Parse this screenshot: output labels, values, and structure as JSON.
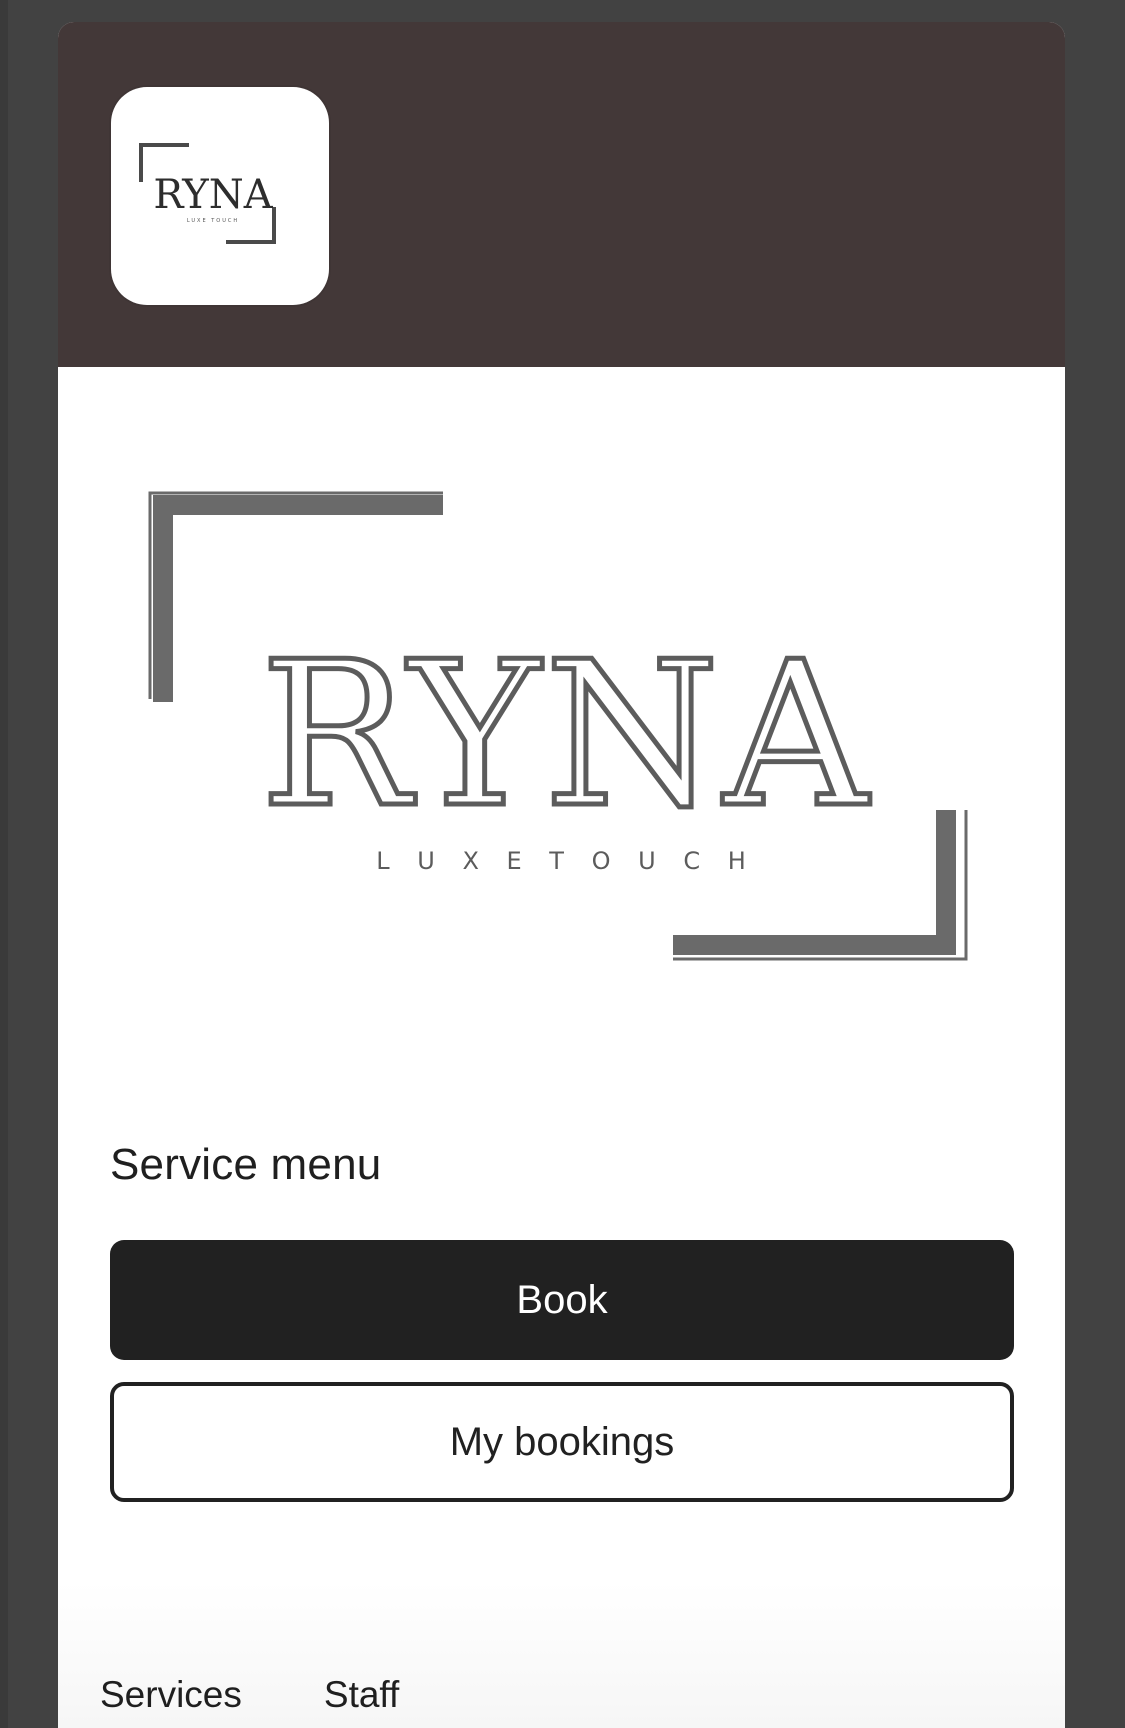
{
  "header": {
    "logo_alt": "RYNA Luxe Touch logo",
    "small_logo": {
      "wordmark": "RYNA",
      "tagline": "LUXE TOUCH"
    }
  },
  "hero": {
    "wordmark": "RYNA",
    "tagline": "L U X E   T O U C H"
  },
  "service_menu": {
    "title": "Service menu",
    "book_label": "Book",
    "my_bookings_label": "My bookings"
  },
  "bottom_tabs": [
    {
      "label": "Services"
    },
    {
      "label": "Staff"
    }
  ],
  "colors": {
    "header_bg": "#433838",
    "frame_bg": "#424242",
    "primary_button": "#212121",
    "logo_gray": "#666666"
  }
}
